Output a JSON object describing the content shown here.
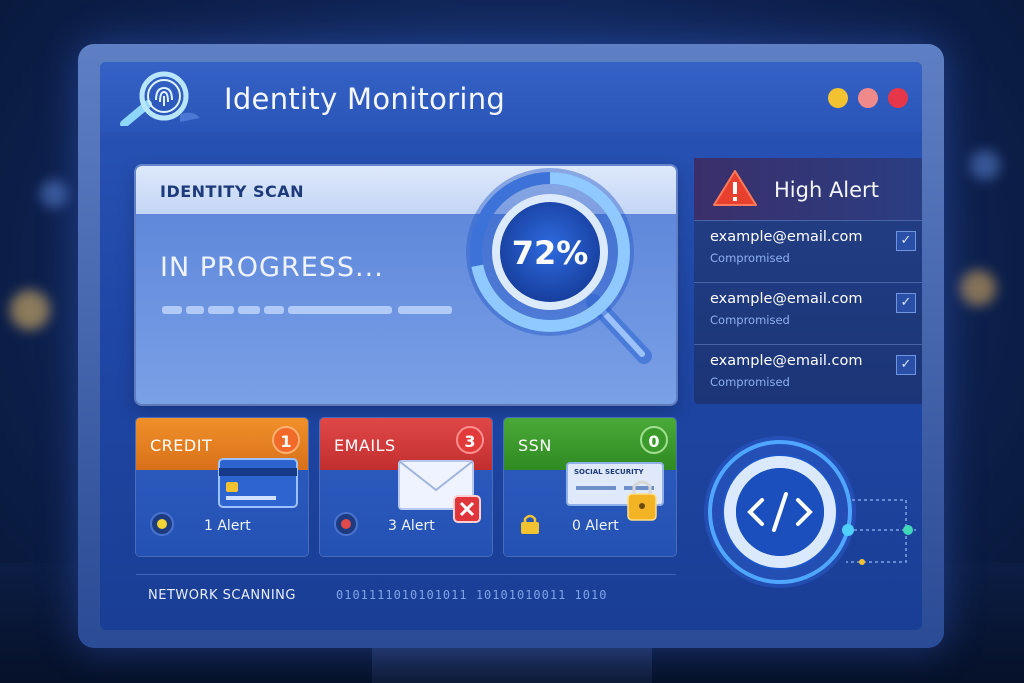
{
  "header": {
    "title": "Identity Monitoring",
    "logo_icon": "fingerprint-search-icon",
    "window_controls": [
      {
        "name": "minimize",
        "color": "#f2c230"
      },
      {
        "name": "maximize",
        "color": "#f08a8a"
      },
      {
        "name": "close",
        "color": "#e6364a"
      }
    ]
  },
  "scan": {
    "title": "IDENTITY SCAN",
    "status": "IN PROGRESS...",
    "percent_label": "72%",
    "progress": 0.72
  },
  "alerts": {
    "title": "High Alert",
    "icon": "warning-triangle-icon",
    "items": [
      {
        "email": "example@email.com",
        "status": "Compromised",
        "checked": true
      },
      {
        "email": "example@email.com",
        "status": "Compromised",
        "checked": true
      },
      {
        "email": "example@email.com",
        "status": "Compromised",
        "checked": true
      }
    ]
  },
  "cards": [
    {
      "title": "CREDIT",
      "count": "1",
      "alert": "1 Alert",
      "color": "#e8831c",
      "icon": "credit-card-icon",
      "indicator": "#f2d234"
    },
    {
      "title": "EMAILS",
      "count": "3",
      "alert": "3 Alert",
      "color": "#d73a3a",
      "icon": "envelope-icon",
      "indicator": "#e04a4a"
    },
    {
      "title": "SSN",
      "count": "0",
      "alert": "0 Alert",
      "color": "#3d9a2e",
      "icon": "social-security-card-icon",
      "indicator": "#f2c230"
    }
  ],
  "ssn_card_text": "SOCIAL SECURITY",
  "network": {
    "label": "NETWORK SCANNING",
    "binary": "0101111010101011 10101010011 1010"
  },
  "code_icon": "code-brackets-icon",
  "colors": {
    "accent": "#2a55b8",
    "highlight": "#4fd0ff"
  }
}
